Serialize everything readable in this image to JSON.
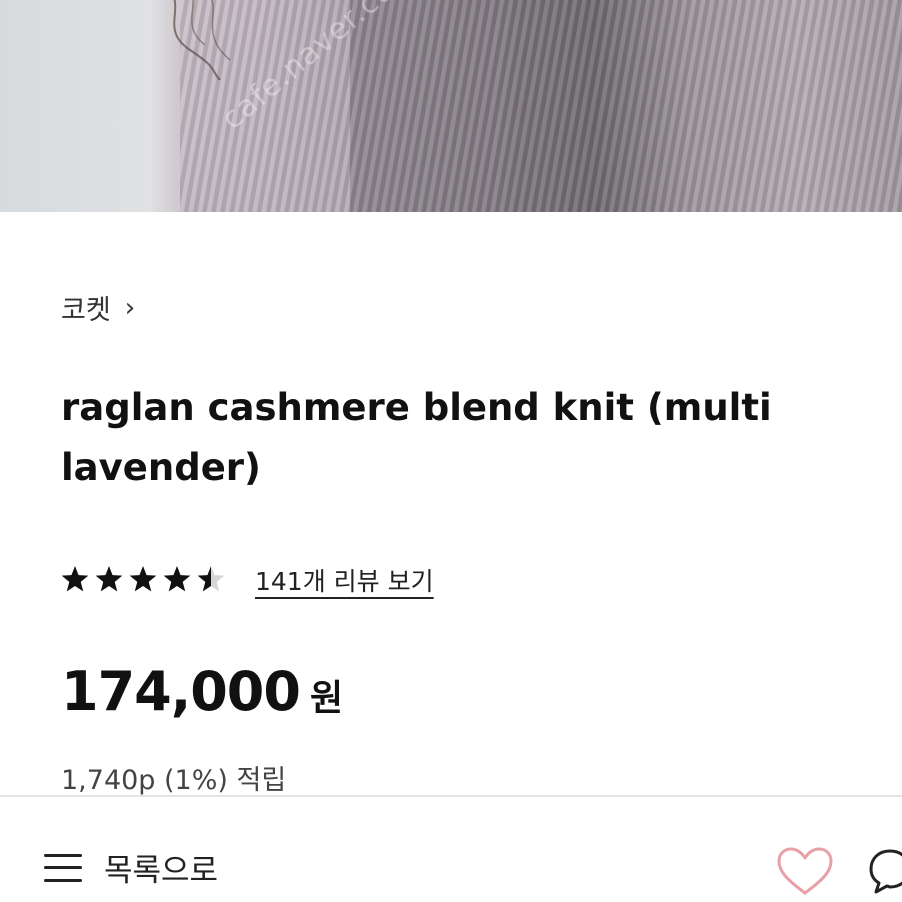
{
  "product_image": {
    "watermark": "cafe.naver.com"
  },
  "breadcrumb": {
    "brand": "코켓",
    "chevron": "›"
  },
  "product": {
    "title": "raglan cashmere blend knit (multi lavender)"
  },
  "rating": {
    "stars": 4.5,
    "max_stars": 5,
    "review_link": "141개 리뷰 보기"
  },
  "price": {
    "amount": "174,000",
    "unit": "원"
  },
  "points": {
    "text": "1,740p (1%) 적립"
  },
  "bottom_bar": {
    "list_label": "목록으로",
    "icons": [
      "menu-icon",
      "heart-icon",
      "chat-icon"
    ],
    "heart_color": "#e8a0a8"
  }
}
